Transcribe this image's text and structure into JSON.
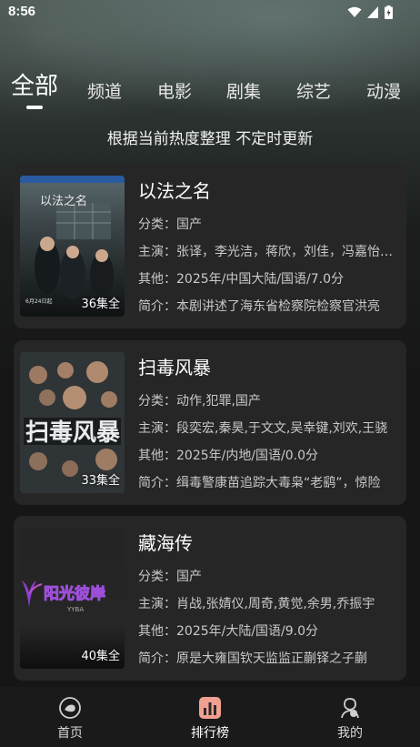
{
  "status_bar": {
    "time": "8:56"
  },
  "tabs": [
    {
      "label": "全部",
      "active": true
    },
    {
      "label": "频道"
    },
    {
      "label": "电影"
    },
    {
      "label": "剧集"
    },
    {
      "label": "综艺"
    },
    {
      "label": "动漫"
    }
  ],
  "subtitle": "根据当前热度整理 不定时更新",
  "items": [
    {
      "title": "以法之名",
      "episodes": "36集全",
      "category": "分类：国产",
      "cast": "主演：张译，李光洁，蒋欣，刘佳，冯嘉怡，孙骁",
      "other": "其他：2025年/中国大陆/国语/7.0分",
      "intro": "简介：本剧讲述了海东省检察院检察官洪亮"
    },
    {
      "title": "扫毒风暴",
      "episodes": "33集全",
      "category": "分类：动作,犯罪,国产",
      "cast": "主演：段奕宏,秦昊,于文文,吴幸键,刘欢,王骁",
      "other": "其他：2025年/内地/国语/0.0分",
      "intro": "简介：缉毒警康苗追踪大毒枭“老鹞”，惊险"
    },
    {
      "title": "藏海传",
      "episodes": "40集全",
      "category": "分类：国产",
      "cast": "主演：肖战,张婧仪,周奇,黄觉,余男,乔振宇",
      "other": "其他：2025年/大陆/国语/9.0分",
      "intro": "简介：原是大雍国钦天监监正蒯铎之子蒯"
    }
  ],
  "poster_logo_text": "阳光彼岸",
  "poster_logo_sub": "YYBA",
  "bottom_nav": [
    {
      "label": "首页",
      "icon": "home-icon"
    },
    {
      "label": "排行榜",
      "icon": "ranking-icon",
      "active": true
    },
    {
      "label": "我的",
      "icon": "profile-icon"
    }
  ],
  "colors": {
    "background": "#161616",
    "card": "#262626",
    "accent_icon": "#f0a090"
  }
}
